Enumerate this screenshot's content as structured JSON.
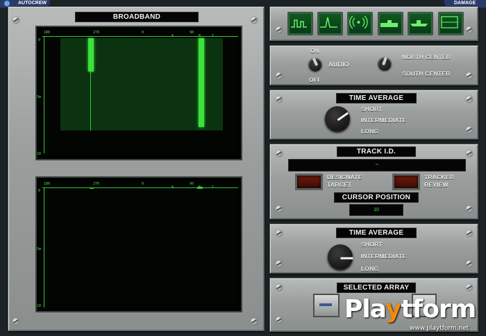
{
  "header": {
    "left_tab": "AUTOCREW",
    "right_tab": "DAMAGE"
  },
  "broadband": {
    "title": "BROADBAND",
    "top_scale": [
      "180",
      "270",
      "0",
      "A",
      "90",
      "B",
      "I"
    ],
    "left_scale": [
      "0",
      "5m",
      "10"
    ],
    "bottom_scale": [
      "180",
      "270",
      "0",
      "A",
      "90",
      "B",
      "I"
    ],
    "bottom_left_scale": [
      "0",
      "5m",
      "10"
    ]
  },
  "audio_panel": {
    "on_label": "ON",
    "off_label": "OFF",
    "audio_label": "AUDIO",
    "north_label": "NORTH CENTER",
    "south_label": "SOUTH CENTER"
  },
  "time_average_1": {
    "title": "TIME AVERAGE",
    "options": [
      "SHORT",
      "INTERMEDIATE",
      "LONG"
    ]
  },
  "track_panel": {
    "title": "TRACK I.D.",
    "track_value": "--",
    "designate_label": "DESIGNATE TARGET",
    "tracker_label": "TRACKER REVIEW",
    "cursor_title": "CURSOR POSITION",
    "cursor_value": "10"
  },
  "time_average_2": {
    "title": "TIME AVERAGE",
    "options": [
      "SHORT",
      "INTERMEDIATE",
      "LONG"
    ]
  },
  "array_panel": {
    "title": "SELECTED ARRAY"
  },
  "watermark": {
    "brand_p": "Pla",
    "brand_y": "y",
    "brand_rest": "tform",
    "url": "www.playtform.net"
  },
  "colors": {
    "screen_green": "#35c735",
    "label_black": "#050505",
    "metal": "#9a9f9d"
  }
}
